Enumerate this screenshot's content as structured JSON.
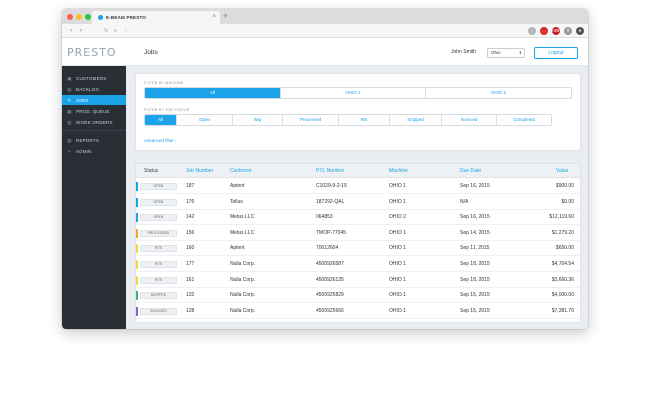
{
  "browser": {
    "tab_title": "E-BEAM PRESTO",
    "new_tab_symbol": "+",
    "close_symbol": "×",
    "back": "‹",
    "forward": "›",
    "reload": "↻",
    "extensions": [
      {
        "icon": "extension-icon",
        "glyph": "↓",
        "color": "#b0b6bd"
      },
      {
        "icon": "lastpass-icon",
        "glyph": "…",
        "color": "#d32d27"
      },
      {
        "icon": "adblock-icon",
        "glyph": "ABP",
        "color": "#c7202b"
      },
      {
        "icon": "share-icon",
        "glyph": "⇧",
        "color": "#9aa0a6"
      },
      {
        "icon": "profile-icon",
        "glyph": "●",
        "color": "#555"
      }
    ]
  },
  "header": {
    "logo": "PRESTO",
    "page_title": "Jobs",
    "user_name": "John Smith",
    "state_selected": "Ohio",
    "state_arrow": "⬍",
    "logout_label": "Logout"
  },
  "sidebar": {
    "items": [
      {
        "label": "CUSTOMERS",
        "icon": "▣",
        "active": false
      },
      {
        "label": "BACKLOG",
        "icon": "▤",
        "active": false
      },
      {
        "label": "JOBS",
        "icon": "✎",
        "active": true
      },
      {
        "label": "PROD. QUEUE",
        "icon": "▦",
        "active": false
      },
      {
        "label": "WORK ORDERS",
        "icon": "▥",
        "active": false
      },
      {
        "label": "REPORTS",
        "icon": "▧",
        "active": false
      },
      {
        "label": "ADMIN",
        "icon": "✂",
        "active": false
      }
    ]
  },
  "filters": {
    "machine_label": "FILTER BY MACHINE",
    "machines": [
      "All",
      "OHIO 1",
      "OHIO 2"
    ],
    "machine_selected": "All",
    "status_label": "FILTER BY JOB STATUS",
    "statuses": [
      "All",
      "Open",
      "Wip",
      "Processed",
      "Rts",
      "Shipped",
      "Invoiced",
      "Completed"
    ],
    "status_selected": "All",
    "advanced_label": "Advanced filter ›"
  },
  "table": {
    "columns": [
      "Status",
      "Job Number",
      "Customer",
      "P.O. Number",
      "Machine",
      "Due Date",
      "Value"
    ],
    "rows": [
      {
        "status": "OPEN",
        "status_color": "#1aa3e8",
        "job": "187",
        "customer": "Aptent",
        "po": "C1029-9-2-15",
        "machine": "OHIO 1",
        "due": "Sep 16, 2015",
        "value": "$900.00"
      },
      {
        "status": "OPEN",
        "status_color": "#1aa3e8",
        "job": "176",
        "customer": "Tellus",
        "po": "187292-QAL",
        "machine": "OHIO 1",
        "due": "N/A",
        "value": "$0.00"
      },
      {
        "status": "OPEN",
        "status_color": "#1aa3e8",
        "job": "142",
        "customer": "Metus LLC",
        "po": "064853",
        "machine": "OHIO 2",
        "due": "Sep 16, 2015",
        "value": "$12,119.60"
      },
      {
        "status": "PROCESSED",
        "status_color": "#f4a623",
        "job": "156",
        "customer": "Metus LLC",
        "po": "TMOP-77045",
        "machine": "OHIO 1",
        "due": "Sep 14, 2015",
        "value": "$1,279.20"
      },
      {
        "status": "RTS",
        "status_color": "#f2d53c",
        "job": "160",
        "customer": "Aptent",
        "po": "70012604",
        "machine": "OHIO 1",
        "due": "Sep 11, 2015",
        "value": "$650.00"
      },
      {
        "status": "RTS",
        "status_color": "#f2d53c",
        "job": "177",
        "customer": "Nulla Corp.",
        "po": "4500926587",
        "machine": "OHIO 1",
        "due": "Sep 18, 2015",
        "value": "$4,704.54"
      },
      {
        "status": "RTS",
        "status_color": "#f2d53c",
        "job": "161",
        "customer": "Nulla Corp.",
        "po": "4500926135",
        "machine": "OHIO 1",
        "due": "Sep 18, 2015",
        "value": "$3,660.36"
      },
      {
        "status": "SHIPPED",
        "status_color": "#2dbd6e",
        "job": "132",
        "customer": "Nulla Corp.",
        "po": "4500925829",
        "machine": "OHIO 1",
        "due": "Sep 15, 2015",
        "value": "$4,000.00"
      },
      {
        "status": "INVOICED",
        "status_color": "#8e5fd0",
        "job": "128",
        "customer": "Nulla Corp.",
        "po": "4500925666",
        "machine": "OHIO 1",
        "due": "Sep 15, 2015",
        "value": "$7,381.70"
      }
    ]
  }
}
